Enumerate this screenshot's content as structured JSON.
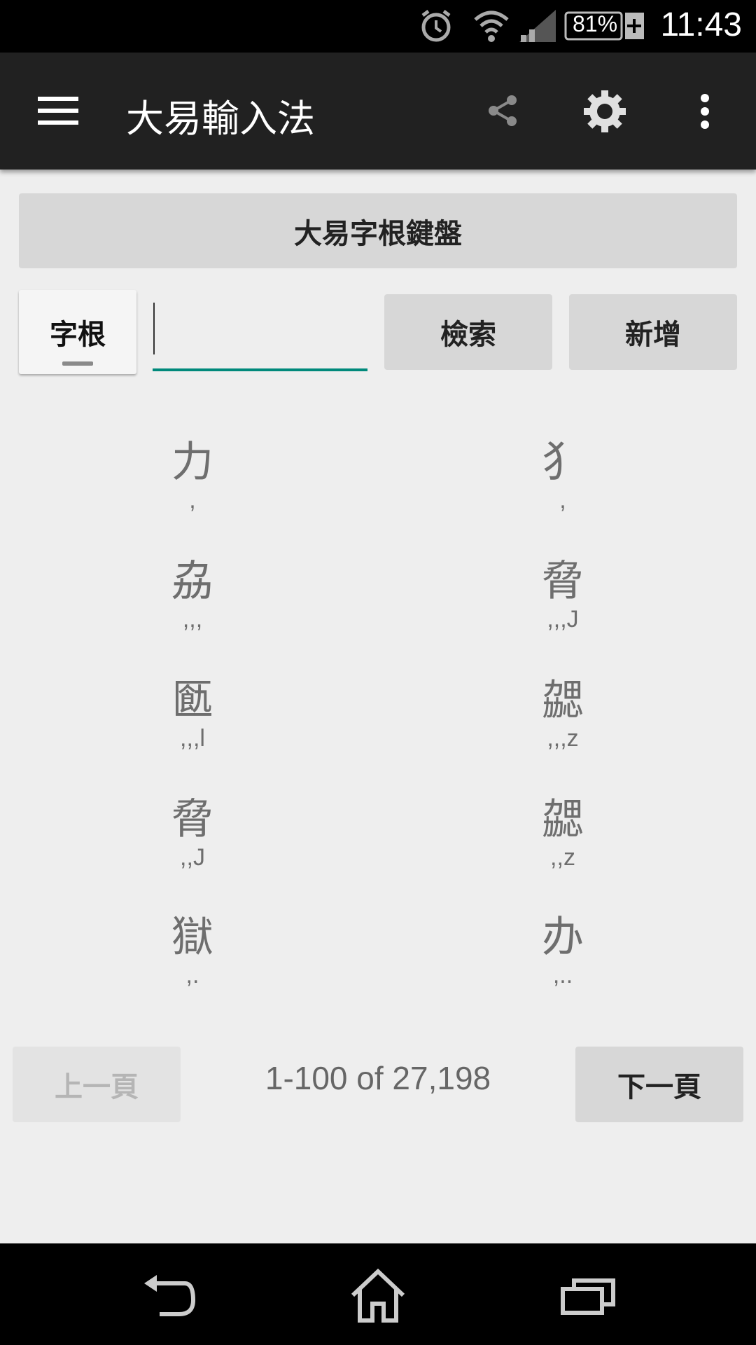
{
  "status_bar": {
    "battery": "81%",
    "time": "11:43",
    "icons": [
      "alarm-icon",
      "wifi-icon",
      "signal-icon",
      "battery-icon"
    ]
  },
  "app_bar": {
    "title": "大易輸入法",
    "icons": [
      "menu-icon",
      "share-icon",
      "gear-icon",
      "overflow-icon"
    ]
  },
  "keyboard_button": "大易字根鍵盤",
  "search": {
    "toggle_label": "字根",
    "value": "",
    "placeholder": "",
    "search_label": "檢索",
    "add_label": "新增"
  },
  "results": [
    {
      "char": "力",
      "code": ","
    },
    {
      "char": "犭",
      "code": ","
    },
    {
      "char": "劦",
      "code": ",,,"
    },
    {
      "char": "脅",
      "code": ",,,J"
    },
    {
      "char": "㔲",
      "code": ",,,l"
    },
    {
      "char": "勰",
      "code": ",,,z"
    },
    {
      "char": "脅",
      "code": ",,J"
    },
    {
      "char": "勰",
      "code": ",,z"
    },
    {
      "char": "獄",
      "code": ",."
    },
    {
      "char": "办",
      "code": ",.."
    }
  ],
  "pager": {
    "prev_label": "上一頁",
    "range_text": "1-100 of 27,198",
    "next_label": "下一頁"
  },
  "nav_bar": {
    "icons": [
      "back-icon",
      "home-icon",
      "recents-icon"
    ]
  },
  "colors": {
    "accent": "#00897b",
    "app_bar": "#212121",
    "background": "#eeeeee",
    "button": "#d7d7d7"
  }
}
